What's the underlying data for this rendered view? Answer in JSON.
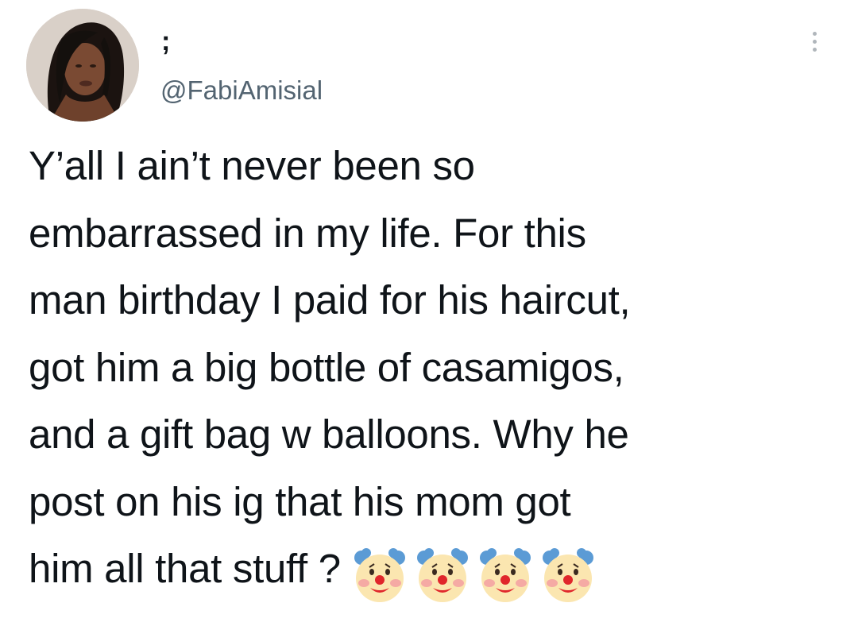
{
  "tweet": {
    "display_name": ";",
    "handle": "@FabiAmisial",
    "text_lines": [
      "Y’all I ain’t never been so",
      "embarrassed in my life. For this",
      "man birthday I paid for his haircut,",
      "got him a big bottle of casamigos,",
      "and a gift bag w balloons. Why he",
      "post on his ig that his mom got",
      "him all that stuff ?"
    ],
    "trailing_emoji": [
      "clown-face",
      "clown-face",
      "clown-face",
      "clown-face"
    ]
  },
  "colors": {
    "text": "#0f1419",
    "secondary_text": "#536471",
    "background": "#ffffff"
  }
}
